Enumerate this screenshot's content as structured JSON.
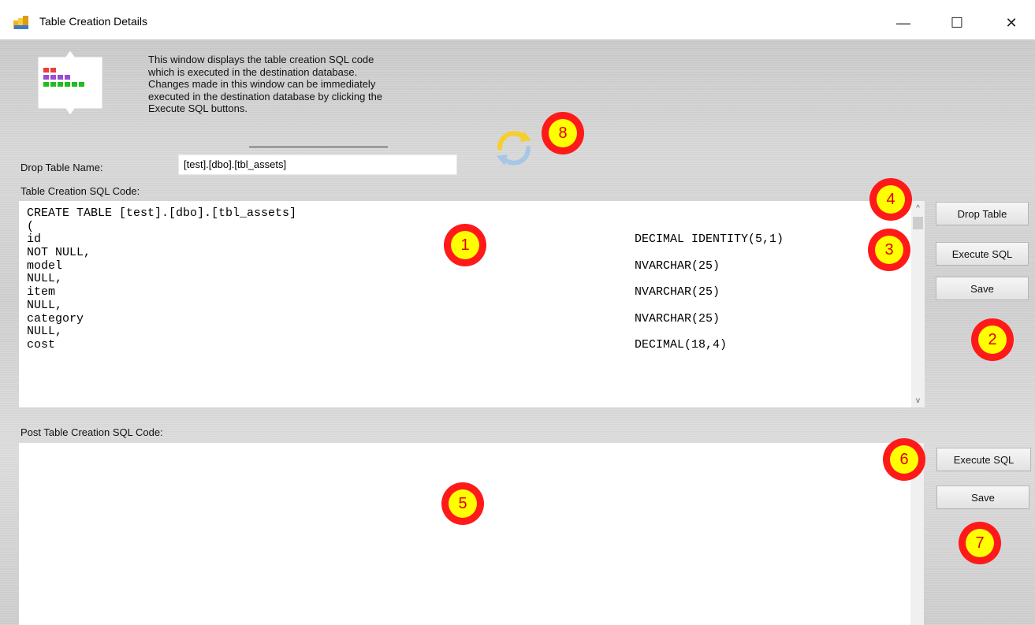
{
  "window": {
    "title": "Table Creation Details",
    "controls": {
      "minimize": "—",
      "maximize": "☐",
      "close": "✕"
    }
  },
  "description": "This window displays the table creation SQL code\nwhich is executed in the destination database.\nChanges made in this window can be immediately\nexecuted in the destination database by clicking the\nExecute SQL buttons.",
  "drop_table": {
    "label": "Drop Table Name:",
    "value": "[test].[dbo].[tbl_assets]"
  },
  "create_sql": {
    "label": "Table Creation SQL Code:",
    "lines": [
      {
        "text": "CREATE TABLE [test].[dbo].[tbl_assets]",
        "type": ""
      },
      {
        "text": "(",
        "type": ""
      },
      {
        "text": "id",
        "type": "DECIMAL IDENTITY(5,1)"
      },
      {
        "text": "NOT NULL,",
        "type": ""
      },
      {
        "text": "model",
        "type": "NVARCHAR(25)"
      },
      {
        "text": "NULL,",
        "type": ""
      },
      {
        "text": "item",
        "type": "NVARCHAR(25)"
      },
      {
        "text": "NULL,",
        "type": ""
      },
      {
        "text": "category",
        "type": "NVARCHAR(25)"
      },
      {
        "text": "NULL,",
        "type": ""
      },
      {
        "text": "cost",
        "type": "DECIMAL(18,4)"
      }
    ]
  },
  "create_buttons": {
    "drop": "Drop Table",
    "execute": "Execute SQL",
    "save": "Save"
  },
  "post_sql": {
    "label": "Post Table Creation SQL Code:",
    "value": ""
  },
  "post_buttons": {
    "execute": "Execute SQL",
    "save": "Save"
  },
  "badges": [
    "1",
    "2",
    "3",
    "4",
    "5",
    "6",
    "7",
    "8"
  ],
  "colors": {
    "badge_ring": "#ff1a1a",
    "badge_fill": "#ffff00",
    "badge_text": "#e00000"
  },
  "icons": {
    "app": "sql-table-icon",
    "logo": "table-blocks-icon",
    "refresh": "refresh-icon"
  }
}
